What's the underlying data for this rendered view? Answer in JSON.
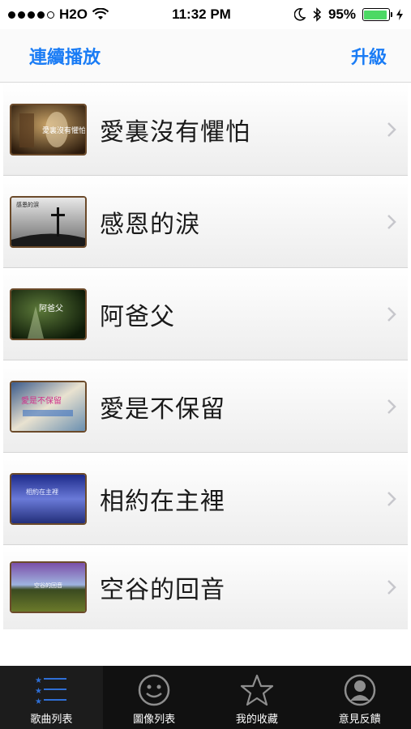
{
  "status_bar": {
    "carrier": "H2O",
    "time": "11:32 PM",
    "battery": "95%"
  },
  "nav": {
    "left_button": "連續播放",
    "right_button": "升級"
  },
  "songs": [
    {
      "title": "愛裏沒有懼怕",
      "thumb_text": "愛裏沒有懼怕"
    },
    {
      "title": "感恩的淚",
      "thumb_text": "感恩的淚"
    },
    {
      "title": "阿爸父",
      "thumb_text": "阿爸父"
    },
    {
      "title": "愛是不保留",
      "thumb_text": "愛是不保留"
    },
    {
      "title": "相約在主裡",
      "thumb_text": "相約在主裡"
    },
    {
      "title": "空谷的回音",
      "thumb_text": "空谷的回音"
    }
  ],
  "tabs": [
    {
      "label": "歌曲列表",
      "icon": "list-icon",
      "active": true
    },
    {
      "label": "圖像列表",
      "icon": "smiley-icon",
      "active": false
    },
    {
      "label": "我的收藏",
      "icon": "star-icon",
      "active": false
    },
    {
      "label": "意見反饋",
      "icon": "person-icon",
      "active": false
    }
  ],
  "colors": {
    "accent": "#1a7cf5",
    "battery": "#4cd964",
    "tab_bar": "#111111"
  }
}
